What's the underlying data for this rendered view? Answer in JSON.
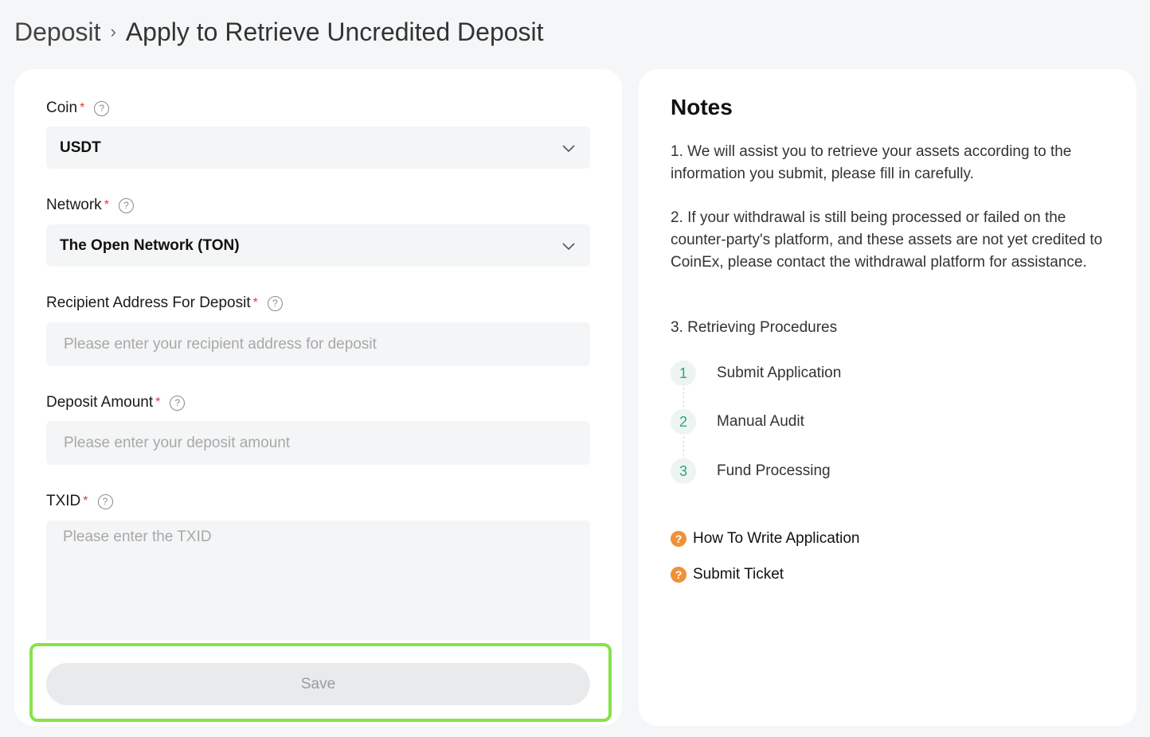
{
  "breadcrumb": {
    "root": "Deposit",
    "separator": "›",
    "current": "Apply to Retrieve Uncredited Deposit"
  },
  "form": {
    "coin": {
      "label": "Coin",
      "required_mark": "*",
      "help": "?",
      "value": "USDT"
    },
    "network": {
      "label": "Network",
      "required_mark": "*",
      "help": "?",
      "value": "The Open Network (TON)"
    },
    "address": {
      "label": "Recipient Address For Deposit",
      "required_mark": "*",
      "help": "?",
      "value": "",
      "placeholder": "Please enter your recipient address for deposit"
    },
    "amount": {
      "label": "Deposit Amount",
      "required_mark": "*",
      "help": "?",
      "value": "",
      "placeholder": "Please enter your deposit amount"
    },
    "txid": {
      "label": "TXID",
      "required_mark": "*",
      "help": "?",
      "value": "",
      "placeholder": "Please enter the TXID"
    },
    "save_label": "Save"
  },
  "notes": {
    "title": "Notes",
    "para1": "1. We will assist you to retrieve your assets according to the information you submit, please fill in carefully.",
    "para2": "2. If your withdrawal is still being processed or failed on the counter-party's platform, and these assets are not yet credited to CoinEx, please contact the withdrawal platform for assistance.",
    "para3": "3. Retrieving Procedures",
    "steps": [
      {
        "num": "1",
        "label": "Submit Application"
      },
      {
        "num": "2",
        "label": "Manual Audit"
      },
      {
        "num": "3",
        "label": "Fund Processing"
      }
    ],
    "links": [
      {
        "icon": "?",
        "label": "How To Write Application"
      },
      {
        "icon": "?",
        "label": "Submit Ticket"
      }
    ]
  },
  "colors": {
    "accent_green": "#2ba586",
    "required_red": "#e23a2e",
    "help_orange": "#f0913a",
    "highlight_green": "#86e34a"
  }
}
